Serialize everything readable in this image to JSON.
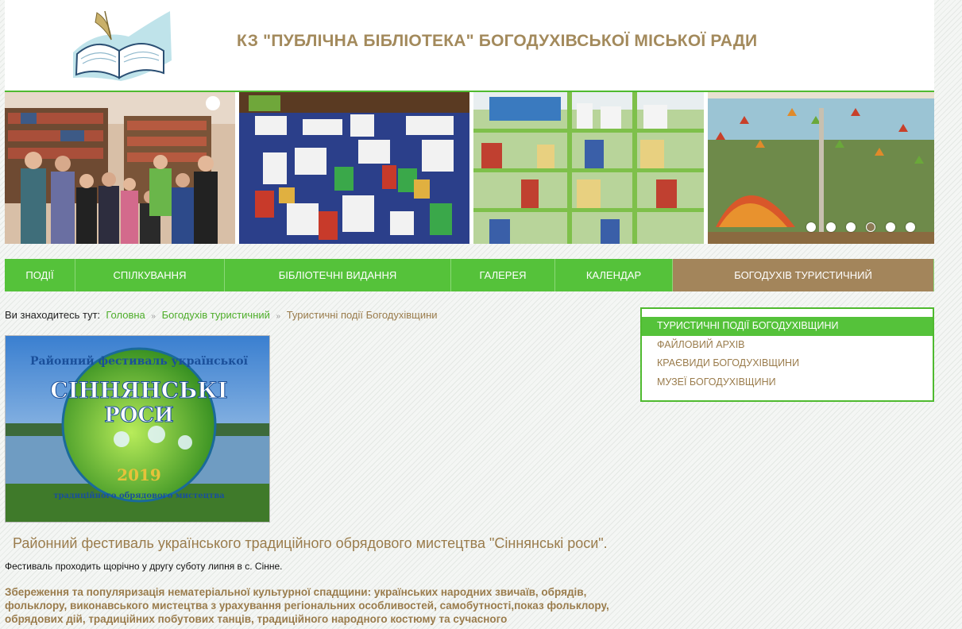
{
  "header": {
    "title": "КЗ \"ПУБЛІЧНА БІБЛІОТЕКА\" БОГОДУХІВСЬКОЇ МІСЬКОЇ РАДИ"
  },
  "slider": {
    "slides": [
      "library-group-photo",
      "book-exhibition",
      "book-shelves",
      "autumn-window-decoration"
    ],
    "dots_count": 6,
    "active_dot": 4
  },
  "nav": {
    "items": [
      {
        "label": "ПОДІЇ"
      },
      {
        "label": "СПІЛКУВАННЯ"
      },
      {
        "label": "БІБЛІОТЕЧНІ ВИДАННЯ"
      },
      {
        "label": "ГАЛЕРЕЯ"
      },
      {
        "label": "КАЛЕНДАР"
      },
      {
        "label": "БОГОДУХІВ ТУРИСТИЧНИЙ"
      }
    ],
    "active_index": 5
  },
  "breadcrumb": {
    "prefix": "Ви знаходитесь тут:",
    "home": "Головна",
    "section": "Богодухів туристичний",
    "current": "Туристичні події Богодухівщини"
  },
  "article": {
    "image_text": {
      "top_arc": "Районний фестиваль української",
      "title_line1": "СІННЯНСЬКІ",
      "title_line2": "РОСИ",
      "bottom_arc": "традиційного обрядового мистецтва",
      "year": "2019"
    },
    "title": "Районний фестиваль українського традиційного обрядового мистецтва \"Сіннянські роси\".",
    "paragraph1": "Фестиваль проходить щорічно у другу суботу липня в с. Сінне.",
    "paragraph2": "Збереження та популяризація нематеріальної культурної спадщини: українських народних звичаїв, обрядів, фольклору, виконавського мистецтва з урахування регіональних особливостей, самобутності,показ фольклору, обрядових дій, традиційних побутових танців, традиційного народного костюму та сучасного"
  },
  "side_menu": {
    "items": [
      {
        "label": "ТУРИСТИЧНІ ПОДІЇ БОГОДУХІВЩИНИ"
      },
      {
        "label": "ФАЙЛОВИЙ АРХІВ"
      },
      {
        "label": "КРАЄВИДИ БОГОДУХІВЩИНИ"
      },
      {
        "label": "МУЗЕЇ БОГОДУХІВЩИНИ"
      }
    ],
    "active_index": 0
  },
  "colors": {
    "green": "#55c23a",
    "brown": "#a3855b",
    "text_brown": "#9a7c4c"
  }
}
